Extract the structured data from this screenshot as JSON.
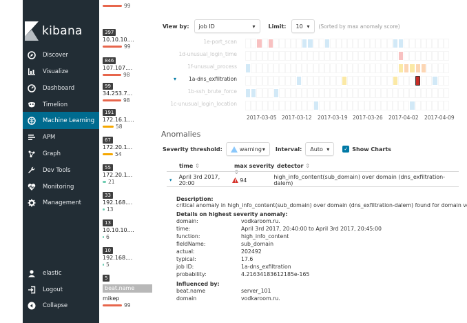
{
  "nav": {
    "brand": "kibana",
    "items": [
      {
        "label": "Discover",
        "icon": "compass-icon"
      },
      {
        "label": "Visualize",
        "icon": "bar-chart-icon"
      },
      {
        "label": "Dashboard",
        "icon": "dashboard-icon"
      },
      {
        "label": "Timelion",
        "icon": "mask-icon"
      },
      {
        "label": "Machine Learning",
        "icon": "brain-icon"
      },
      {
        "label": "APM",
        "icon": "list-icon"
      },
      {
        "label": "Graph",
        "icon": "graph-icon"
      },
      {
        "label": "Dev Tools",
        "icon": "wrench-icon"
      },
      {
        "label": "Monitoring",
        "icon": "heartbeat-icon"
      },
      {
        "label": "Management",
        "icon": "gear-icon"
      }
    ],
    "bottom": [
      {
        "label": "elastic",
        "icon": "user-icon"
      },
      {
        "label": "Logout",
        "icon": "logout-icon"
      },
      {
        "label": "Collapse",
        "icon": "collapse-icon"
      }
    ],
    "active_color": "#006b8f"
  },
  "influencers": {
    "top_value": "99",
    "items": [
      {
        "count": "397",
        "label": "10.10.10....",
        "score": "99",
        "color": "#e7664c"
      },
      {
        "count": "846",
        "label": "107.107....",
        "score": "98",
        "color": "#e7664c"
      },
      {
        "count": "99",
        "label": "34.253.7...",
        "score": "98",
        "color": "#e7664c"
      },
      {
        "count": "191",
        "label": "172.16.1....",
        "score": "58",
        "color": "#f5a700"
      },
      {
        "count": "67",
        "label": "172.20.1...",
        "score": "54",
        "color": "#f5a700"
      },
      {
        "count": "55",
        "label": "172.20.1...",
        "score": "21",
        "color": "#6dccb1"
      },
      {
        "count": "33",
        "label": "192.168....",
        "score": "13",
        "color": "#6dccb1"
      },
      {
        "count": "13",
        "label": "10.10.10....",
        "score": "6",
        "color": "#6dccb1"
      },
      {
        "count": "10",
        "label": "192.168....",
        "score": "5",
        "color": "#6dccb1"
      },
      {
        "count": "5",
        "label": "",
        "score": "",
        "color": ""
      }
    ],
    "section_head": "beat.name",
    "section_item": "mikep",
    "section_score": "99"
  },
  "toolbar": {
    "view_by_label": "View by:",
    "view_by_value": "job ID",
    "limit_label": "Limit:",
    "limit_value": "10",
    "hint": "(Sorted by max anomaly score)"
  },
  "swimlane": {
    "lanes": [
      "1e-port_scan",
      "1d-unusual_login_time",
      "1f-unusual_process",
      "1a-dns_exfiltration",
      "1b-ssh_brute_force",
      "1c-unusual_login_location"
    ],
    "active_lane": 3,
    "ticks": [
      "2017-03-05",
      "2017-03-12",
      "2017-03-19",
      "2017-03-26",
      "2017-04-02",
      "2017-04-09"
    ],
    "colors": {
      "low": "#d2e9f7",
      "warning": "#fbe9a6",
      "minor": "#fcd6b4",
      "major": "#f8c1c1",
      "critical": "#c72c26"
    }
  },
  "anomalies": {
    "title": "Anomalies",
    "severity_label": "Severity threshold:",
    "severity_value": "warning",
    "interval_label": "Interval:",
    "interval_value": "Auto",
    "show_charts_label": "Show Charts",
    "columns": {
      "time": "time",
      "severity": "max severity",
      "detector": "detector"
    },
    "row": {
      "time": "April 3rd 2017, 20:00",
      "severity": "94",
      "detector": "high_info_content(sub_domain) over domain (dns_exfiltration-dalem)"
    },
    "details": {
      "description_title": "Description:",
      "description": "critical anomaly in high_info_content(sub_domain) over domain (dns_exfiltration-dalem) found for domain vodka",
      "highest_title": "Details on highest severity anomaly:",
      "fields": [
        {
          "k": "domain:",
          "v": "vodkaroom.ru."
        },
        {
          "k": "time:",
          "v": "April 3rd 2017, 20:40:00 to April 3rd 2017, 20:45:00"
        },
        {
          "k": "function:",
          "v": "high_info_content"
        },
        {
          "k": "fieldName:",
          "v": "sub_domain"
        },
        {
          "k": "actual:",
          "v": "202492"
        },
        {
          "k": "typical:",
          "v": "17.6"
        },
        {
          "k": "job ID:",
          "v": "1a-dns_exfiltration"
        },
        {
          "k": "probability:",
          "v": "4.21634183612185​e-165"
        }
      ],
      "influenced_title": "Influenced by:",
      "influenced": [
        {
          "k": "beat.name",
          "v": "server_101"
        },
        {
          "k": "domain",
          "v": "vodkaroom.ru."
        }
      ]
    }
  }
}
